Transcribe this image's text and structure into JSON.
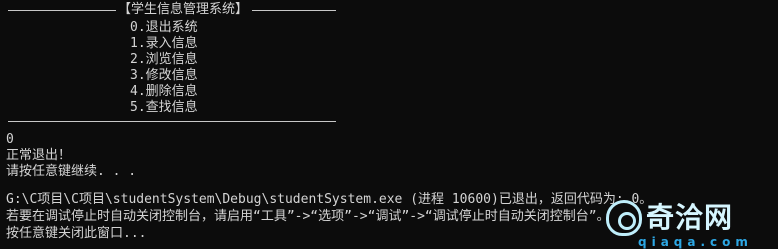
{
  "console": {
    "menu_title": "【学生信息管理系统】",
    "menu_items": [
      "0.退出系统",
      "1.录入信息",
      "2.浏览信息",
      "3.修改信息",
      "4.删除信息",
      "5.查找信息"
    ],
    "divider": "——————————————————————————————————————————————",
    "input_value": "0",
    "normal_exit": "正常退出！",
    "press_any_key": "请按任意键继续. . .",
    "process_exit": "G:\\C项目\\C项目\\studentSystem\\Debug\\studentSystem.exe (进程 10600)已退出，返回代码为: 0。",
    "auto_close_hint": "若要在调试停止时自动关闭控制台，请启用“工具”->“选项”->“调试”->“调试停止时自动关闭控制台”。",
    "press_close": "按任意键关闭此窗口..."
  },
  "watermark": {
    "brand": "奇洽网",
    "domain": "qiaqa.com",
    "icon": "qiaqa-logo-icon"
  },
  "colors": {
    "console_background": "#0c0c0c",
    "console_text": "#d4d4d4",
    "watermark_domain": "#2da7e4"
  }
}
